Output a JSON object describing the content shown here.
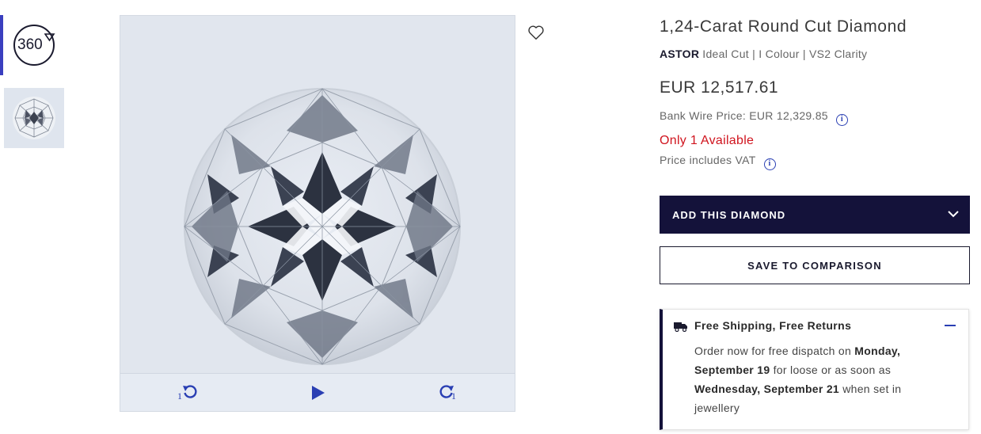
{
  "gallery": {
    "thumb_360_label": "360",
    "thumb_still_alt": "diamond-thumbnail"
  },
  "viewer": {
    "rotate_left_step": "1",
    "rotate_right_step": "1",
    "icons": [
      "rotate-left-icon",
      "play-icon",
      "rotate-right-icon",
      "heart-icon"
    ]
  },
  "product": {
    "title": "1,24-Carat Round Cut Diamond",
    "brand": "ASTOR",
    "specs": "Ideal Cut | I Colour | VS2 Clarity",
    "price": "EUR 12,517.61",
    "bank_wire_price": "Bank Wire Price: EUR 12,329.85",
    "availability": "Only 1 Available",
    "vat_note": "Price includes VAT"
  },
  "actions": {
    "add_label": "ADD THIS DIAMOND",
    "save_label": "SAVE TO COMPARISON"
  },
  "shipping": {
    "heading": "Free Shipping, Free Returns",
    "text_1": "Order now for free dispatch on ",
    "date_1": "Monday, September 19",
    "text_2": " for loose or as soon as ",
    "date_2": "Wednesday, September 21",
    "text_3": " when set in jewellery"
  },
  "colors": {
    "accent_blue": "#2a3fb3",
    "navy": "#14123a",
    "availability_red": "#d0141e"
  }
}
